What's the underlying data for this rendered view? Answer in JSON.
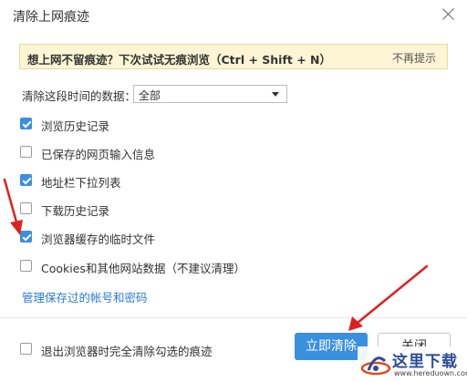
{
  "dialog": {
    "title": "清除上网痕迹"
  },
  "banner": {
    "message": "想上网不留痕迹？下次试试无痕浏览（Ctrl + Shift + N）",
    "dismiss_label": "不再提示"
  },
  "range": {
    "label": "清除这段时间的数据：",
    "selected": "全部"
  },
  "options": [
    {
      "label": "浏览历史记录",
      "checked": true
    },
    {
      "label": "已保存的网页输入信息",
      "checked": false
    },
    {
      "label": "地址栏下拉列表",
      "checked": true
    },
    {
      "label": "下载历史记录",
      "checked": false
    },
    {
      "label": "浏览器缓存的临时文件",
      "checked": true
    },
    {
      "label": "Cookies和其他网站数据（不建议清理）",
      "checked": false
    }
  ],
  "manage_link": "管理保存过的帐号和密码",
  "footer": {
    "clear_on_exit_label": "退出浏览器时完全清除勾选的痕迹",
    "clear_on_exit_checked": false,
    "clear_now_label": "立即清除",
    "close_label": "关闭"
  },
  "watermark": {
    "text": "这里下载",
    "url": "www.hereduown.com"
  },
  "colors": {
    "accent": "#3a8fde",
    "banner_bg": "#fdf5d4",
    "annotation_arrow": "#e02020",
    "link": "#2a7bd3"
  }
}
